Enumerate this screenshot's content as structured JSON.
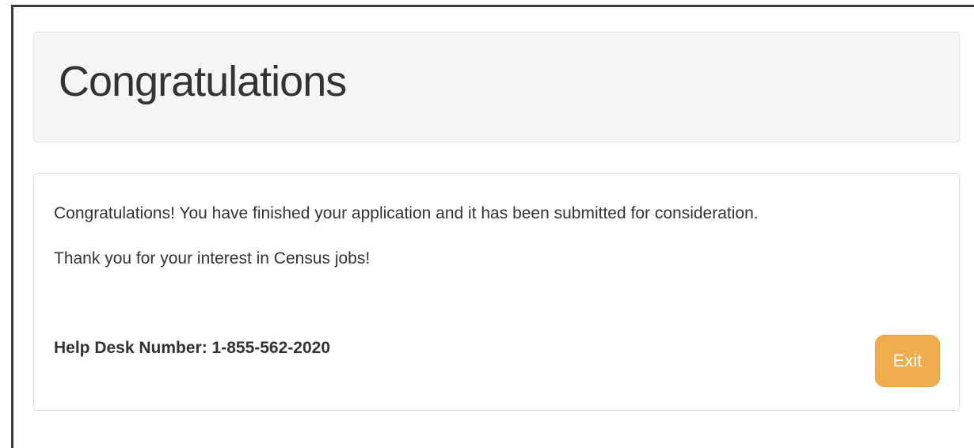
{
  "header": {
    "title": "Congratulations"
  },
  "panel": {
    "message_line_1": "Congratulations! You have finished your application and it has been submitted for consideration.",
    "message_line_2": "Thank you for your interest in Census jobs!",
    "help_desk": "Help Desk Number: 1-855-562-2020",
    "exit_label": "Exit"
  },
  "colors": {
    "exit_button": "#f0ad4e",
    "header_background": "#f5f5f5",
    "text": "#333333"
  }
}
